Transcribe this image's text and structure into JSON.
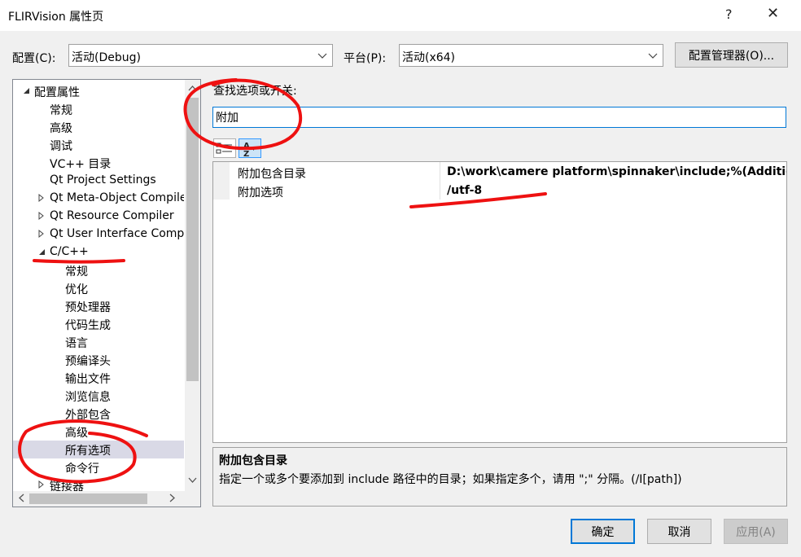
{
  "window": {
    "title": "FLIRVision 属性页",
    "help": "?",
    "close": "✕"
  },
  "config_bar": {
    "config_label": "配置(C):",
    "config_value": "活动(Debug)",
    "platform_label": "平台(P):",
    "platform_value": "活动(x64)",
    "manager_button": "配置管理器(O)..."
  },
  "tree": {
    "items": [
      {
        "label": "配置属性",
        "indent": 0,
        "expander": "expanded"
      },
      {
        "label": "常规",
        "indent": 1,
        "expander": "none"
      },
      {
        "label": "高级",
        "indent": 1,
        "expander": "none"
      },
      {
        "label": "调试",
        "indent": 1,
        "expander": "none"
      },
      {
        "label": "VC++ 目录",
        "indent": 1,
        "expander": "none"
      },
      {
        "label": "Qt Project Settings",
        "indent": 1,
        "expander": "none"
      },
      {
        "label": "Qt Meta-Object Compiler",
        "indent": 1,
        "expander": "collapsed"
      },
      {
        "label": "Qt Resource Compiler",
        "indent": 1,
        "expander": "collapsed"
      },
      {
        "label": "Qt User Interface Compiler",
        "indent": 1,
        "expander": "collapsed"
      },
      {
        "label": "C/C++",
        "indent": 1,
        "expander": "expanded"
      },
      {
        "label": "常规",
        "indent": 2,
        "expander": "none"
      },
      {
        "label": "优化",
        "indent": 2,
        "expander": "none"
      },
      {
        "label": "预处理器",
        "indent": 2,
        "expander": "none"
      },
      {
        "label": "代码生成",
        "indent": 2,
        "expander": "none"
      },
      {
        "label": "语言",
        "indent": 2,
        "expander": "none"
      },
      {
        "label": "预编译头",
        "indent": 2,
        "expander": "none"
      },
      {
        "label": "输出文件",
        "indent": 2,
        "expander": "none"
      },
      {
        "label": "浏览信息",
        "indent": 2,
        "expander": "none"
      },
      {
        "label": "外部包含",
        "indent": 2,
        "expander": "none"
      },
      {
        "label": "高级",
        "indent": 2,
        "expander": "none"
      },
      {
        "label": "所有选项",
        "indent": 2,
        "expander": "none",
        "selected": true
      },
      {
        "label": "命令行",
        "indent": 2,
        "expander": "none"
      },
      {
        "label": "链接器",
        "indent": 1,
        "expander": "collapsed"
      }
    ]
  },
  "search": {
    "label": "查找选项或开关:",
    "value": "附加"
  },
  "grid": {
    "rows": [
      {
        "name": "附加包含目录",
        "value": "D:\\work\\camere platform\\spinnaker\\include;%(AdditionalIncludeDirectories)"
      },
      {
        "name": "附加选项",
        "value": "/utf-8"
      }
    ]
  },
  "description": {
    "title": "附加包含目录",
    "text": "指定一个或多个要添加到 include 路径中的目录；如果指定多个，请用 \";\" 分隔。(/I[path])"
  },
  "footer": {
    "ok": "确定",
    "cancel": "取消",
    "apply": "应用(A)"
  },
  "colors": {
    "annotation": "#ee1111",
    "selection_gray": "#d9d9e6",
    "focus_blue": "#0078d7"
  },
  "icons": {
    "category_view": "list-category-icon",
    "sort_alpha": "sort-az-icon"
  }
}
